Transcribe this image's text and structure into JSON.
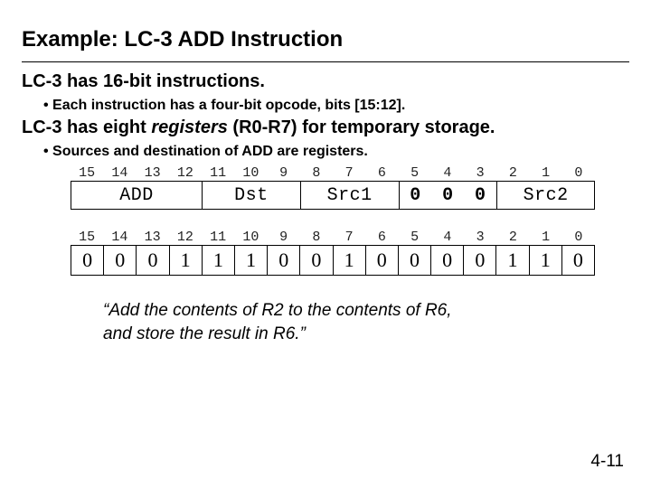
{
  "title": "Example: LC-3 ADD Instruction",
  "line1": "LC-3 has 16-bit instructions.",
  "bullet1": "Each instruction has a four-bit opcode, bits [15:12].",
  "line2_pre": "LC-3 has eight ",
  "line2_em": "registers",
  "line2_post": " (R0-R7) for temporary storage.",
  "bullet2": "Sources and destination of ADD are registers.",
  "bit_indices": [
    "15",
    "14",
    "13",
    "12",
    "11",
    "10",
    "9",
    "8",
    "7",
    "6",
    "5",
    "4",
    "3",
    "2",
    "1",
    "0"
  ],
  "fields": {
    "opcode": "ADD",
    "dst": "Dst",
    "src1": "Src1",
    "mode_bits": [
      "0",
      "0",
      "0"
    ],
    "src2": "Src2"
  },
  "example_bits": [
    "0",
    "0",
    "0",
    "1",
    "1",
    "1",
    "0",
    "0",
    "1",
    "0",
    "0",
    "0",
    "0",
    "1",
    "1",
    "0"
  ],
  "caption_l1": "“Add the contents of R2 to the contents of R6,",
  "caption_l2": "and store the result in R6.”",
  "page": "4-11"
}
